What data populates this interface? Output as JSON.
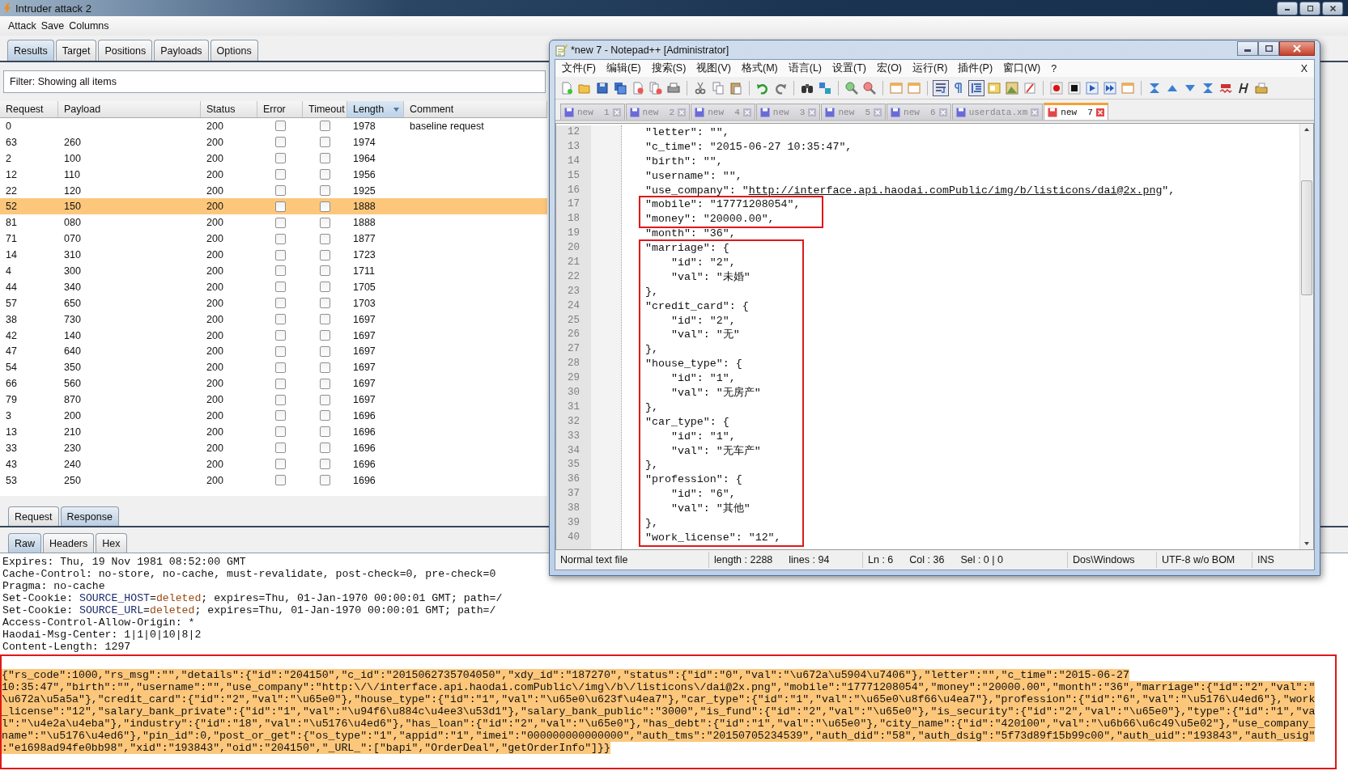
{
  "window": {
    "title": "Intruder attack 2"
  },
  "menu": [
    "Attack",
    "Save",
    "Columns"
  ],
  "tabs": [
    {
      "label": "Results",
      "selected": true
    },
    {
      "label": "Target",
      "selected": false
    },
    {
      "label": "Positions",
      "selected": false
    },
    {
      "label": "Payloads",
      "selected": false
    },
    {
      "label": "Options",
      "selected": false
    }
  ],
  "filter": "Filter:  Showing all items",
  "table": {
    "columns": [
      {
        "label": "Request",
        "sorted": false
      },
      {
        "label": "Payload",
        "sorted": false
      },
      {
        "label": "Status",
        "sorted": false
      },
      {
        "label": "Error",
        "sorted": false
      },
      {
        "label": "Timeout",
        "sorted": false
      },
      {
        "label": "Length",
        "sorted": true
      },
      {
        "label": "Comment",
        "sorted": false
      }
    ],
    "rows": [
      {
        "request": "0",
        "payload": "",
        "status": "200",
        "error": false,
        "timeout": false,
        "length": "1978",
        "comment": "baseline request",
        "selected": false
      },
      {
        "request": "63",
        "payload": "260",
        "status": "200",
        "error": false,
        "timeout": false,
        "length": "1974",
        "comment": "",
        "selected": false
      },
      {
        "request": "2",
        "payload": "100",
        "status": "200",
        "error": false,
        "timeout": false,
        "length": "1964",
        "comment": "",
        "selected": false
      },
      {
        "request": "12",
        "payload": "110",
        "status": "200",
        "error": false,
        "timeout": false,
        "length": "1956",
        "comment": "",
        "selected": false
      },
      {
        "request": "22",
        "payload": "120",
        "status": "200",
        "error": false,
        "timeout": false,
        "length": "1925",
        "comment": "",
        "selected": false
      },
      {
        "request": "52",
        "payload": "150",
        "status": "200",
        "error": false,
        "timeout": false,
        "length": "1888",
        "comment": "",
        "selected": true
      },
      {
        "request": "81",
        "payload": "080",
        "status": "200",
        "error": false,
        "timeout": false,
        "length": "1888",
        "comment": "",
        "selected": false
      },
      {
        "request": "71",
        "payload": "070",
        "status": "200",
        "error": false,
        "timeout": false,
        "length": "1877",
        "comment": "",
        "selected": false
      },
      {
        "request": "14",
        "payload": "310",
        "status": "200",
        "error": false,
        "timeout": false,
        "length": "1723",
        "comment": "",
        "selected": false
      },
      {
        "request": "4",
        "payload": "300",
        "status": "200",
        "error": false,
        "timeout": false,
        "length": "1711",
        "comment": "",
        "selected": false
      },
      {
        "request": "44",
        "payload": "340",
        "status": "200",
        "error": false,
        "timeout": false,
        "length": "1705",
        "comment": "",
        "selected": false
      },
      {
        "request": "57",
        "payload": "650",
        "status": "200",
        "error": false,
        "timeout": false,
        "length": "1703",
        "comment": "",
        "selected": false
      },
      {
        "request": "38",
        "payload": "730",
        "status": "200",
        "error": false,
        "timeout": false,
        "length": "1697",
        "comment": "",
        "selected": false
      },
      {
        "request": "42",
        "payload": "140",
        "status": "200",
        "error": false,
        "timeout": false,
        "length": "1697",
        "comment": "",
        "selected": false
      },
      {
        "request": "47",
        "payload": "640",
        "status": "200",
        "error": false,
        "timeout": false,
        "length": "1697",
        "comment": "",
        "selected": false
      },
      {
        "request": "54",
        "payload": "350",
        "status": "200",
        "error": false,
        "timeout": false,
        "length": "1697",
        "comment": "",
        "selected": false
      },
      {
        "request": "66",
        "payload": "560",
        "status": "200",
        "error": false,
        "timeout": false,
        "length": "1697",
        "comment": "",
        "selected": false
      },
      {
        "request": "79",
        "payload": "870",
        "status": "200",
        "error": false,
        "timeout": false,
        "length": "1697",
        "comment": "",
        "selected": false
      },
      {
        "request": "3",
        "payload": "200",
        "status": "200",
        "error": false,
        "timeout": false,
        "length": "1696",
        "comment": "",
        "selected": false
      },
      {
        "request": "13",
        "payload": "210",
        "status": "200",
        "error": false,
        "timeout": false,
        "length": "1696",
        "comment": "",
        "selected": false
      },
      {
        "request": "33",
        "payload": "230",
        "status": "200",
        "error": false,
        "timeout": false,
        "length": "1696",
        "comment": "",
        "selected": false
      },
      {
        "request": "43",
        "payload": "240",
        "status": "200",
        "error": false,
        "timeout": false,
        "length": "1696",
        "comment": "",
        "selected": false
      },
      {
        "request": "53",
        "payload": "250",
        "status": "200",
        "error": false,
        "timeout": false,
        "length": "1696",
        "comment": "",
        "selected": false
      }
    ]
  },
  "message_tabs": [
    {
      "label": "Request",
      "selected": false
    },
    {
      "label": "Response",
      "selected": true
    }
  ],
  "view_tabs": [
    {
      "label": "Raw",
      "selected": true
    },
    {
      "label": "Headers",
      "selected": false
    },
    {
      "label": "Hex",
      "selected": false
    }
  ],
  "response": {
    "header_lines": [
      [
        {
          "text": "Expires: Thu, 19 Nov 1981 08:52:00 GMT",
          "kind": "plain"
        }
      ],
      [
        {
          "text": "Cache-Control: no-store, no-cache, must-revalidate, post-check=0, pre-check=0",
          "kind": "plain"
        }
      ],
      [
        {
          "text": "Pragma: no-cache",
          "kind": "plain"
        }
      ],
      [
        {
          "text": "Set-Cookie: ",
          "kind": "plain"
        },
        {
          "text": "SOURCE_HOST",
          "kind": "name"
        },
        {
          "text": "=",
          "kind": "plain"
        },
        {
          "text": "deleted",
          "kind": "value"
        },
        {
          "text": "; expires=Thu, 01-Jan-1970 00:00:01 GMT; path=/",
          "kind": "plain"
        }
      ],
      [
        {
          "text": "Set-Cookie: ",
          "kind": "plain"
        },
        {
          "text": "SOURCE_URL",
          "kind": "name"
        },
        {
          "text": "=",
          "kind": "plain"
        },
        {
          "text": "deleted",
          "kind": "value"
        },
        {
          "text": "; expires=Thu, 01-Jan-1970 00:00:01 GMT; path=/",
          "kind": "plain"
        }
      ],
      [
        {
          "text": "Access-Control-Allow-Origin: *",
          "kind": "plain"
        }
      ],
      [
        {
          "text": "Haodai-Msg-Center: 1|1|0|10|8|2",
          "kind": "plain"
        }
      ],
      [
        {
          "text": "Content-Length: 1297",
          "kind": "plain"
        }
      ]
    ],
    "body": {
      "boxed": true,
      "selected": true,
      "lines": [
        "{\"rs_code\":1000,\"rs_msg\":\"\",\"details\":{\"id\":\"204150\",\"c_id\":\"2015062735704050\",\"xdy_id\":\"187270\",\"status\":{\"id\":\"0\",\"val\":\"\\u672a\\u5904\\u7406\"},\"letter\":\"\",\"c_time\":\"2015-06-27",
        "10:35:47\",\"birth\":\"\",\"username\":\"\",\"use_company\":\"http:\\/\\/interface.api.haodai.comPublic\\/img\\/b\\/listicons\\/dai@2x.png\",\"mobile\":\"17771208054\",\"money\":\"20000.00\",\"month\":\"36\",\"marriage\":{\"id\":\"2\",\"val\":\"",
        "\\u672a\\u5a5a\"},\"credit_card\":{\"id\":\"2\",\"val\":\"\\u65e0\"},\"house_type\":{\"id\":\"1\",\"val\":\"\\u65e0\\u623f\\u4ea7\"},\"car_type\":{\"id\":\"1\",\"val\":\"\\u65e0\\u8f66\\u4ea7\"},\"profession\":{\"id\":\"6\",\"val\":\"\\u5176\\u4ed6\"},\"work",
        "_license\":\"12\",\"salary_bank_private\":{\"id\":\"1\",\"val\":\"\\u94f6\\u884c\\u4ee3\\u53d1\"},\"salary_bank_public\":\"3000\",\"is_fund\":{\"id\":\"2\",\"val\":\"\\u65e0\"},\"is_security\":{\"id\":\"2\",\"val\":\"\\u65e0\"},\"type\":{\"id\":\"1\",\"va",
        "l\":\"\\u4e2a\\u4eba\"},\"industry\":{\"id\":\"18\",\"val\":\"\\u5176\\u4ed6\"},\"has_loan\":{\"id\":\"2\",\"val\":\"\\u65e0\"},\"has_debt\":{\"id\":\"1\",\"val\":\"\\u65e0\"},\"city_name\":{\"id\":\"420100\",\"val\":\"\\u6b66\\u6c49\\u5e02\"},\"use_company_",
        "name\":\"\\u5176\\u4ed6\"},\"pin_id\":0,\"post_or_get\":{\"os_type\":\"1\",\"appid\":\"1\",\"imei\":\"000000000000000\",\"auth_tms\":\"20150705234539\",\"auth_did\":\"58\",\"auth_dsig\":\"5f73d89f15b99c00\",\"auth_uid\":\"193843\",\"auth_usig\"",
        ":\"e1698ad94fe0bb98\",\"xid\":\"193843\",\"oid\":\"204150\",\"_URL_\":[\"bapi\",\"OrderDeal\",\"getOrderInfo\"]}}"
      ]
    }
  },
  "notepad": {
    "title": "*new  7 - Notepad++ [Administrator]",
    "menu": [
      "文件(F)",
      "编辑(E)",
      "搜索(S)",
      "视图(V)",
      "格式(M)",
      "语言(L)",
      "设置(T)",
      "宏(O)",
      "运行(R)",
      "插件(P)",
      "窗口(W)",
      "?"
    ],
    "menu_close": "X",
    "doc_tabs": [
      {
        "label": "new  1",
        "selected": false
      },
      {
        "label": "new  2",
        "selected": false
      },
      {
        "label": "new  4",
        "selected": false
      },
      {
        "label": "new  3",
        "selected": false
      },
      {
        "label": "new  5",
        "selected": false
      },
      {
        "label": "new  6",
        "selected": false
      },
      {
        "label": "userdata.xm",
        "selected": false
      },
      {
        "label": "new  7",
        "selected": true
      }
    ],
    "editor": {
      "blocks": [
        {
          "boxed": false,
          "lines": [
            {
              "number": "12",
              "text": "\"letter\": \"\","
            },
            {
              "number": "13",
              "text": "\"c_time\": \"2015-06-27 10:35:47\","
            },
            {
              "number": "14",
              "text": "\"birth\": \"\","
            },
            {
              "number": "15",
              "text": "\"username\": \"\","
            },
            {
              "number": "16",
              "text": "\"use_company\": \"",
              "link": "http://interface.api.haodai.comPublic/img/b/listicons/dai@2x.png",
              "after": "\","
            }
          ]
        },
        {
          "boxed": true,
          "lines": [
            {
              "number": "17",
              "text": "\"mobile\": \"17771208054\","
            },
            {
              "number": "18",
              "text": "\"money\": \"20000.00\","
            }
          ]
        },
        {
          "boxed": false,
          "lines": [
            {
              "number": "19",
              "text": "\"month\": \"36\","
            }
          ]
        },
        {
          "boxed": true,
          "lines": [
            {
              "number": "20",
              "text": "\"marriage\": {"
            },
            {
              "number": "21",
              "text": "    \"id\": \"2\","
            },
            {
              "number": "22",
              "text": "    \"val\": \"未婚\""
            },
            {
              "number": "23",
              "text": "},"
            },
            {
              "number": "24",
              "text": "\"credit_card\": {"
            },
            {
              "number": "25",
              "text": "    \"id\": \"2\","
            },
            {
              "number": "26",
              "text": "    \"val\": \"无\""
            },
            {
              "number": "27",
              "text": "},"
            },
            {
              "number": "28",
              "text": "\"house_type\": {"
            },
            {
              "number": "29",
              "text": "    \"id\": \"1\","
            },
            {
              "number": "30",
              "text": "    \"val\": \"无房产\""
            },
            {
              "number": "31",
              "text": "},"
            },
            {
              "number": "32",
              "text": "\"car_type\": {"
            },
            {
              "number": "33",
              "text": "    \"id\": \"1\","
            },
            {
              "number": "34",
              "text": "    \"val\": \"无车产\""
            },
            {
              "number": "35",
              "text": "},"
            },
            {
              "number": "36",
              "text": "\"profession\": {"
            },
            {
              "number": "37",
              "text": "    \"id\": \"6\","
            },
            {
              "number": "38",
              "text": "    \"val\": \"其他\""
            },
            {
              "number": "39",
              "text": "},"
            },
            {
              "number": "40",
              "text": "\"work_license\": \"12\","
            }
          ]
        }
      ]
    },
    "status_bar": {
      "type": "Normal text file",
      "length": "length : 2288",
      "lines": "lines : 94",
      "ln": "Ln : 6",
      "col": "Col : 36",
      "sel": "Sel : 0 | 0",
      "eol": "Dos\\Windows",
      "encoding": "UTF-8 w/o BOM",
      "mode": "INS"
    }
  }
}
